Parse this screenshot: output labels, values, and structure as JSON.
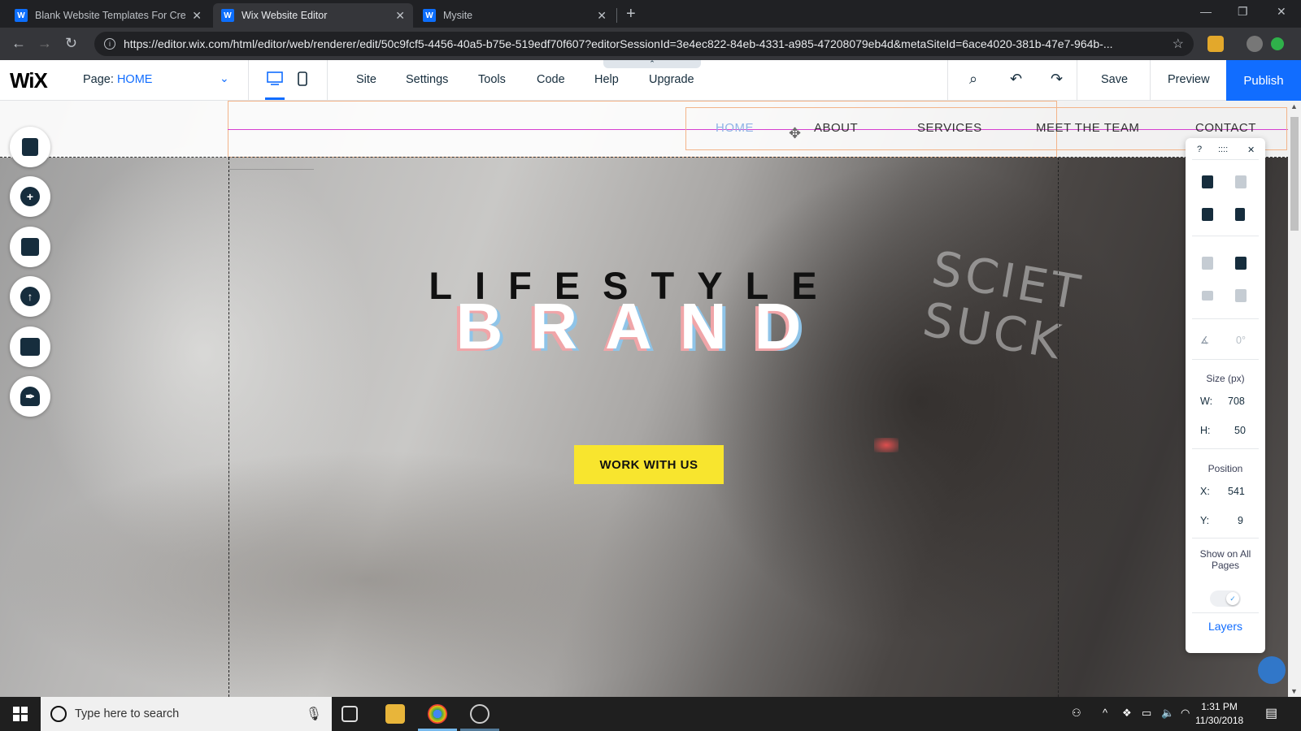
{
  "browser": {
    "tabs": [
      {
        "title": "Blank Website Templates For Cre",
        "close": "✕"
      },
      {
        "title": "Wix Website Editor",
        "close": "✕"
      },
      {
        "title": "Mysite",
        "close": "✕"
      }
    ],
    "new_tab": "+",
    "url": "https://editor.wix.com/html/editor/web/renderer/edit/50c9fcf5-4456-40a5-b75e-519edf70f607?editorSessionId=3e4ec822-84eb-4331-a985-47208079eb4d&metaSiteId=6ace4020-381b-47e7-964b-..."
  },
  "editor": {
    "logo": "WiX",
    "page_label": "Page:",
    "page_name": "HOME",
    "menu": [
      "Site",
      "Settings",
      "Tools",
      "Code",
      "Help",
      "Upgrade"
    ],
    "save": "Save",
    "preview": "Preview",
    "publish": "Publish"
  },
  "site": {
    "nav": [
      "HOME",
      "ABOUT",
      "SERVICES",
      "MEET THE TEAM",
      "CONTACT"
    ],
    "hero_sub": "LIFESTYLE",
    "hero_main": "BRAND",
    "cta": "WORK WITH US",
    "shirt_line1": "SCIET",
    "shirt_line2": "SUCK"
  },
  "panel": {
    "help": "?",
    "drag": "::::",
    "close": "✕",
    "rotation": "0°",
    "size_label": "Size (px)",
    "w_label": "W:",
    "w_value": "708",
    "h_label": "H:",
    "h_value": "50",
    "position_label": "Position",
    "x_label": "X:",
    "x_value": "541",
    "y_label": "Y:",
    "y_value": "9",
    "show_all_pages": "Show on All Pages",
    "layers": "Layers"
  },
  "taskbar": {
    "search_placeholder": "Type here to search",
    "time": "1:31 PM",
    "date": "11/30/2018"
  },
  "colors": {
    "wix_blue": "#116dff",
    "cta_yellow": "#f8e52e",
    "selection_orange": "#f3b489",
    "guide_magenta": "#d63fd0"
  }
}
